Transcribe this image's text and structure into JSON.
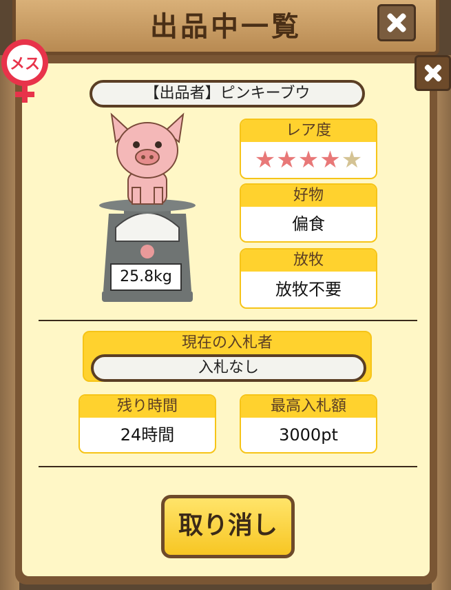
{
  "header": {
    "title": "出品中一覧"
  },
  "gender_badge": {
    "label": "メス"
  },
  "listing": {
    "seller_label": "【出品者】ピンキーブウ",
    "weight": "25.8kg",
    "rarity": {
      "label": "レア度",
      "stars_filled": 4,
      "stars_total": 5
    },
    "favorite": {
      "label": "好物",
      "value": "偏食"
    },
    "grazing": {
      "label": "放牧",
      "value": "放牧不要"
    }
  },
  "bidder": {
    "label": "現在の入札者",
    "value": "入札なし"
  },
  "time_left": {
    "label": "残り時間",
    "value": "24時間"
  },
  "max_bid": {
    "label": "最高入札額",
    "value": "3000pt"
  },
  "actions": {
    "cancel_label": "取り消し"
  },
  "colors": {
    "accent": "#ffd22e",
    "wood": "#6d4a2a",
    "panel": "#fff7c6",
    "star_on": "#e87878",
    "star_off": "#d4c394"
  }
}
